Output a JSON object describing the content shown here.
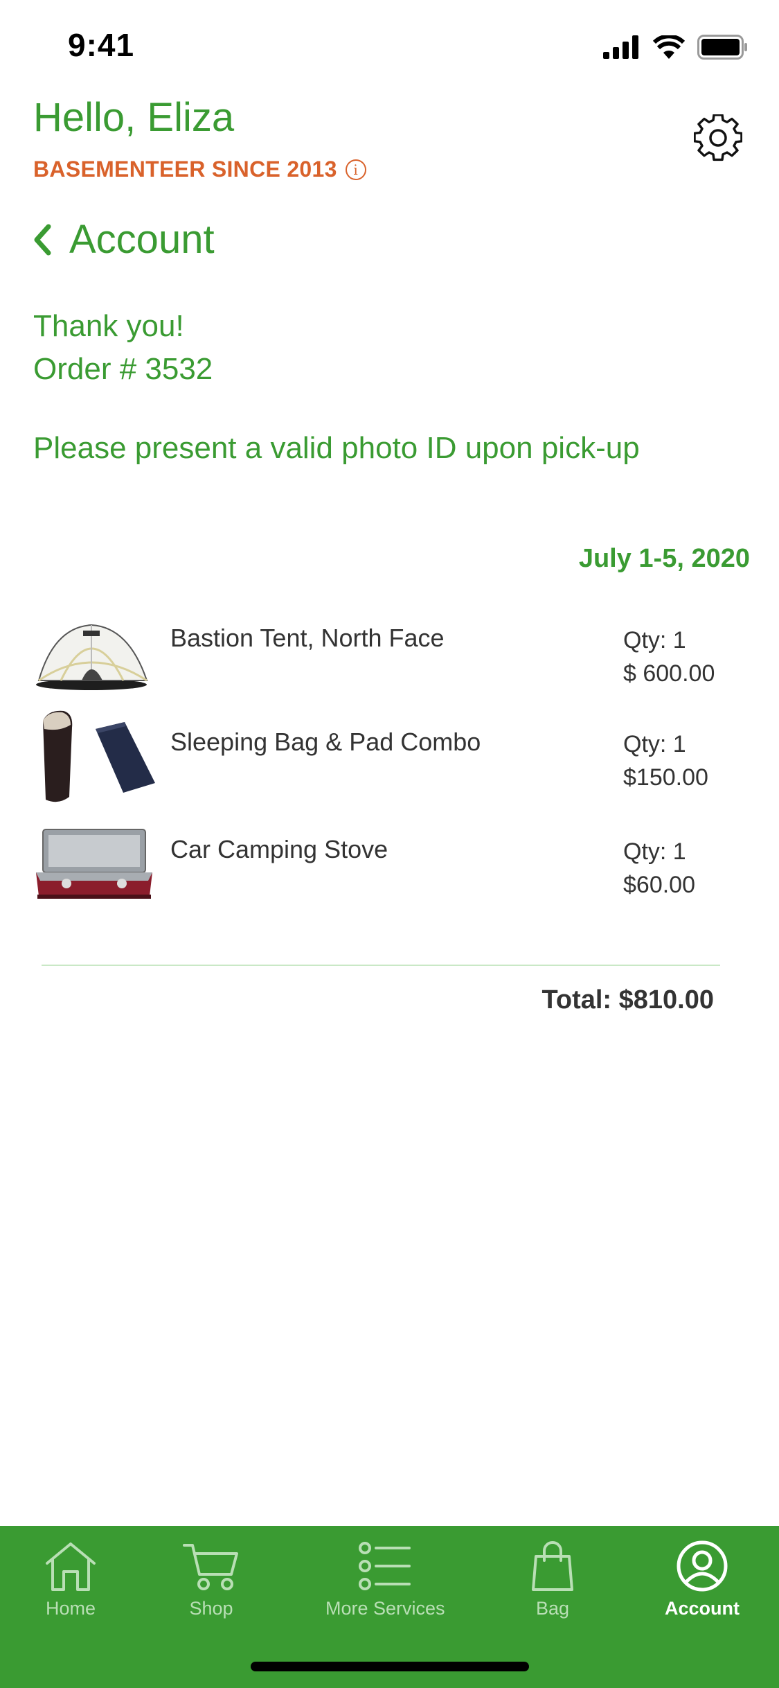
{
  "status_bar": {
    "time": "9:41"
  },
  "header": {
    "greeting": "Hello, Eliza",
    "member_since": "BASEMENTEER SINCE 2013",
    "info_icon": "info-icon",
    "settings_icon": "gear-icon"
  },
  "nav": {
    "back_label": "Account",
    "back_icon": "chevron-left-icon"
  },
  "confirmation": {
    "thanks": "Thank you!",
    "order": "Order # 3532",
    "notice": "Please present a valid photo ID upon pick-up"
  },
  "order": {
    "dates": "July 1-5, 2020",
    "items": [
      {
        "name": "Bastion Tent, North Face",
        "qty": "Qty: 1",
        "price": "$ 600.00"
      },
      {
        "name": "Sleeping Bag & Pad Combo",
        "qty": "Qty: 1",
        "price": "$150.00"
      },
      {
        "name": "Car Camping Stove",
        "qty": "Qty: 1",
        "price": "$60.00"
      }
    ],
    "total": "Total: $810.00"
  },
  "tabbar": {
    "tabs": [
      {
        "label": "Home",
        "icon": "home-icon"
      },
      {
        "label": "Shop",
        "icon": "cart-icon"
      },
      {
        "label": "More Services",
        "icon": "list-icon"
      },
      {
        "label": "Bag",
        "icon": "bag-icon"
      },
      {
        "label": "Account",
        "icon": "account-icon",
        "active": true
      }
    ]
  },
  "colors": {
    "brand_green": "#3a9b32",
    "accent_orange": "#d9622b",
    "text_dark": "#333333"
  }
}
